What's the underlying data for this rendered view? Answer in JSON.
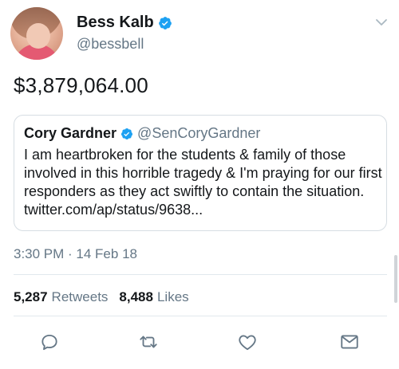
{
  "author": {
    "name": "Bess Kalb",
    "handle": "@bessbell",
    "verified": true
  },
  "tweet_text": "$3,879,064.00",
  "quoted_tweet": {
    "name": "Cory Gardner",
    "handle": "@SenCoryGardner",
    "verified": true,
    "text": "I am heartbroken for the students & family of those involved in this horrible tragedy & I'm praying for our first responders as they act swiftly to contain the situation. twitter.com/ap/status/9638..."
  },
  "timestamp": "3:30 PM · 14 Feb 18",
  "stats": {
    "retweets_count": "5,287",
    "retweets_label": "Retweets",
    "likes_count": "8,488",
    "likes_label": "Likes"
  },
  "icons": {
    "verified": "verified-badge-icon",
    "caret": "chevron-down-icon",
    "reply": "reply-icon",
    "retweet": "retweet-icon",
    "like": "heart-icon",
    "dm": "envelope-icon"
  },
  "colors": {
    "verified_blue": "#1da1f2",
    "secondary_text": "#657786",
    "primary_text": "#14171a",
    "border": "#d6dde3"
  }
}
